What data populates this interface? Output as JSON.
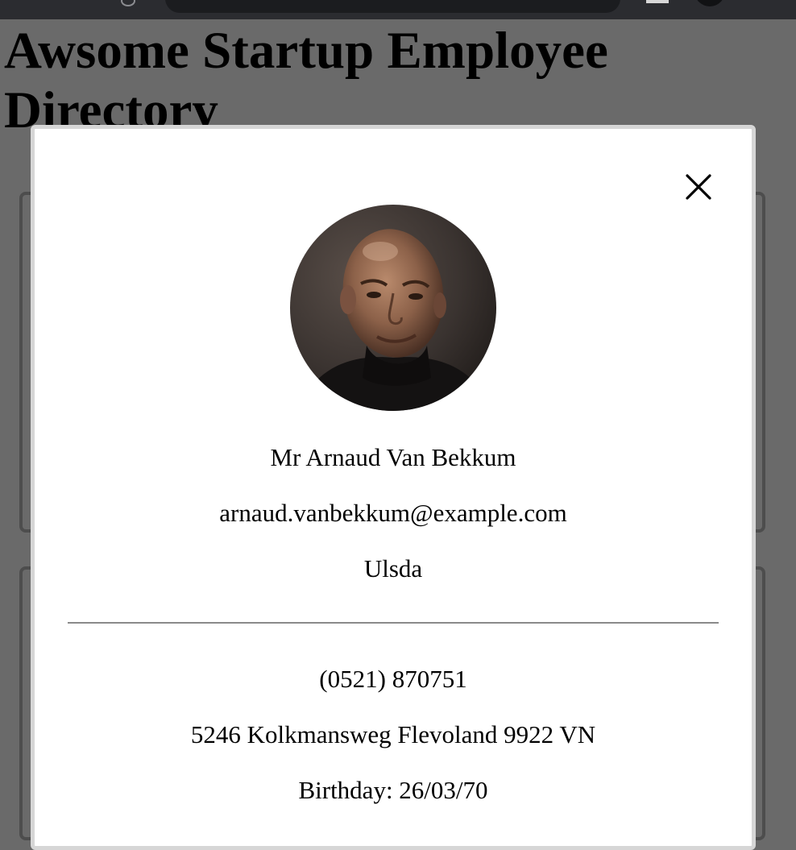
{
  "page": {
    "title": "Awsome Startup Employee Directory"
  },
  "modal": {
    "name": "Mr Arnaud Van Bekkum",
    "email": "arnaud.vanbekkum@example.com",
    "city": "Ulsda",
    "phone": "(0521) 870751",
    "address": "5246 Kolkmansweg Flevoland 9922 VN",
    "birthday": "Birthday: 26/03/70",
    "close_icon": "close-icon",
    "photo_alt": ""
  },
  "colors": {
    "overlay": "#6a6a6a",
    "modal_bg": "#ffffff",
    "modal_border": "#d6d6d6",
    "card_border": "#4d4d4d",
    "divider": "#8a8a8a"
  }
}
